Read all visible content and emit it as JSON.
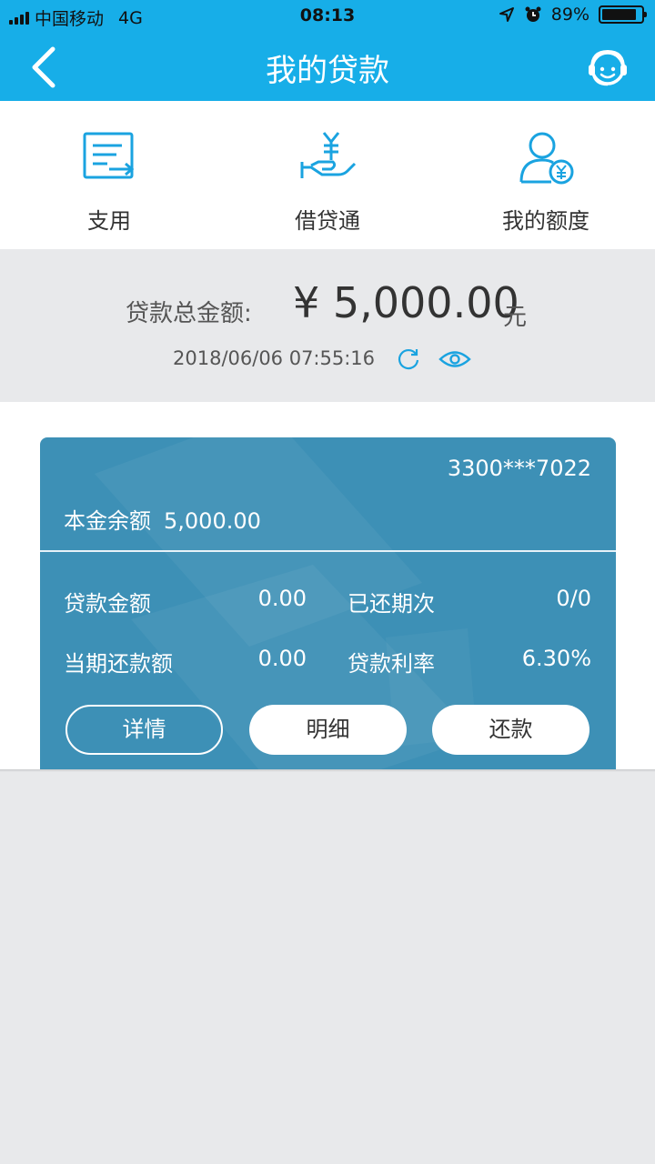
{
  "status_bar": {
    "carrier": "中国移动",
    "network": "4G",
    "time": "08:13",
    "battery": "89%",
    "battery_level": 0.89
  },
  "nav": {
    "title": "我的贷款",
    "back_icon": "chevron-left-icon",
    "support_icon": "customer-service-icon"
  },
  "shortcuts": [
    {
      "label": "支用",
      "icon": "withdraw-document-icon"
    },
    {
      "label": "借贷通",
      "icon": "hand-yuan-icon"
    },
    {
      "label": "我的额度",
      "icon": "user-yuan-icon"
    }
  ],
  "summary": {
    "total_label": "贷款总金额:",
    "total_amount": "¥ 5,000.00",
    "total_unit": "元",
    "timestamp": "2018/06/06 07:55:16"
  },
  "card": {
    "account": "3300***7022",
    "principal_label": "本金余额",
    "principal_value": "5,000.00",
    "loan_amount_label": "贷款金额",
    "loan_amount_value": "0.00",
    "repaid_periods_label": "已还期次",
    "repaid_periods_value": "0/0",
    "current_repay_label": "当期还款额",
    "current_repay_value": "0.00",
    "rate_label": "贷款利率",
    "rate_value": "6.30%",
    "buttons": {
      "details": "详情",
      "statement": "明细",
      "repay": "还款"
    }
  },
  "colors": {
    "header": "#17aee8",
    "card": "#3d90b6",
    "accent_icon": "#1aa3e0"
  }
}
